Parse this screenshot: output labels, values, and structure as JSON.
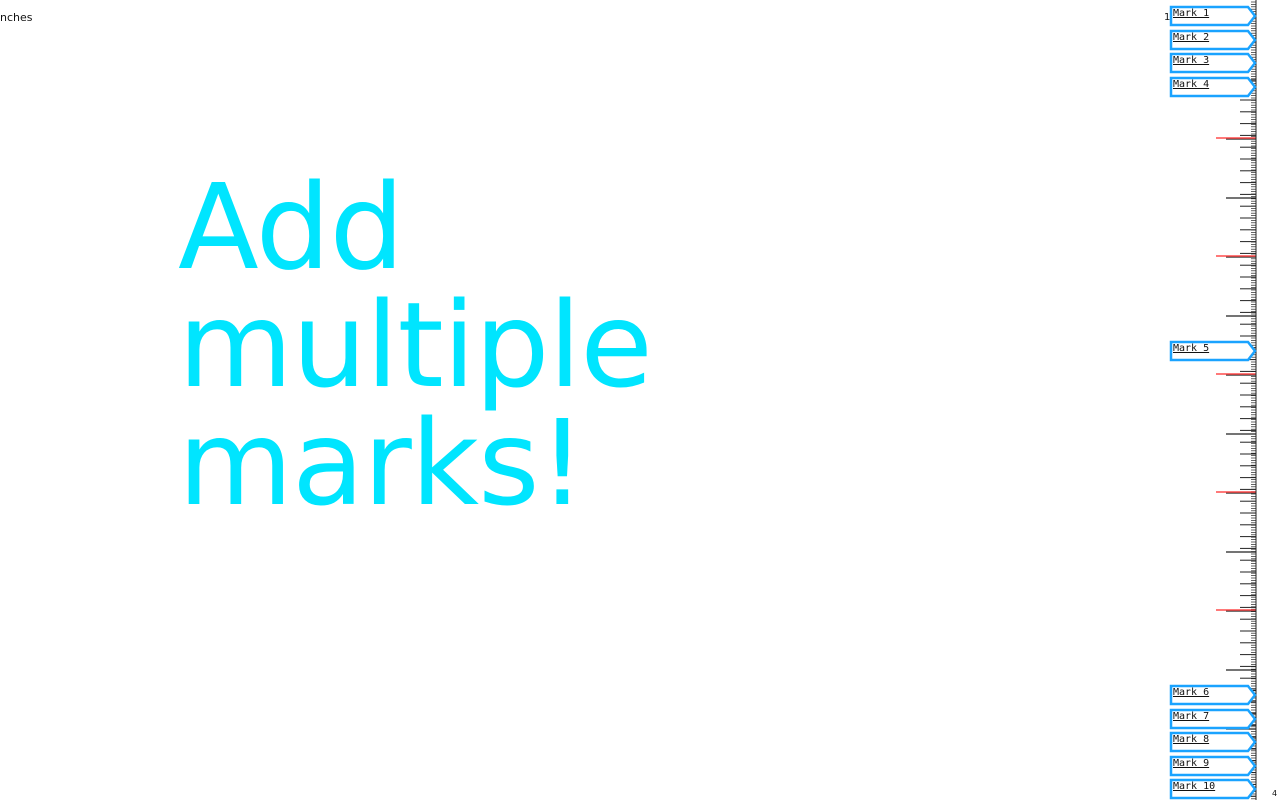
{
  "unit_label": "nches",
  "headline": {
    "line1": "Add",
    "line2": "multiple",
    "line3": "marks!"
  },
  "ruler": {
    "top_number": "1",
    "bottom_number": "4",
    "marks": [
      {
        "label": "Mark 1"
      },
      {
        "label": "Mark 2"
      },
      {
        "label": "Mark 3"
      },
      {
        "label": "Mark 4"
      },
      {
        "label": "Mark 5"
      },
      {
        "label": "Mark 6"
      },
      {
        "label": "Mark 7"
      },
      {
        "label": "Mark 8"
      },
      {
        "label": "Mark 9"
      },
      {
        "label": "Mark 10"
      }
    ]
  },
  "colors": {
    "headline": "#00e5ff",
    "mark_border": "#1aa3ff",
    "ruler_tick": "#222222",
    "ruler_highlight": "#ff4d4d"
  }
}
